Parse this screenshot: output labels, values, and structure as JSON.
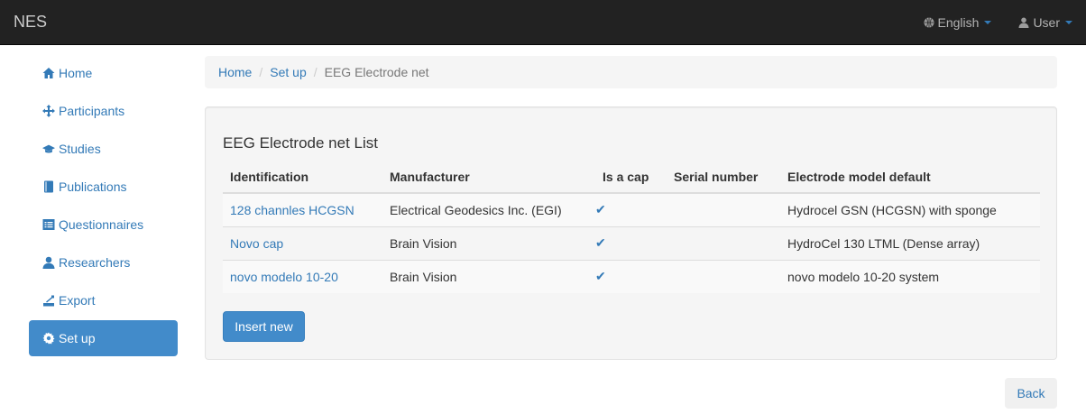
{
  "navbar": {
    "brand": "NES",
    "language": "English",
    "user": "User"
  },
  "sidebar": {
    "items": [
      {
        "label": "Home",
        "icon": "home-icon"
      },
      {
        "label": "Participants",
        "icon": "move-icon"
      },
      {
        "label": "Studies",
        "icon": "education-icon"
      },
      {
        "label": "Publications",
        "icon": "book-icon"
      },
      {
        "label": "Questionnaires",
        "icon": "list-alt-icon"
      },
      {
        "label": "Researchers",
        "icon": "user-icon"
      },
      {
        "label": "Export",
        "icon": "export-icon"
      },
      {
        "label": "Set up",
        "icon": "cog-icon",
        "active": true
      }
    ]
  },
  "breadcrumb": {
    "home": "Home",
    "setup": "Set up",
    "current": "EEG Electrode net"
  },
  "panel": {
    "title": "EEG Electrode net List",
    "columns": [
      "Identification",
      "Manufacturer",
      "Is a cap",
      "Serial number",
      "Electrode model default"
    ],
    "rows": [
      {
        "identification": "128 channles HCGSN",
        "manufacturer": "Electrical Geodesics Inc. (EGI)",
        "is_cap": "✔",
        "serial": "",
        "model": "Hydrocel GSN (HCGSN) with sponge"
      },
      {
        "identification": "Novo cap",
        "manufacturer": "Brain Vision",
        "is_cap": "✔",
        "serial": "",
        "model": "HydroCel 130 LTML (Dense array)"
      },
      {
        "identification": "novo modelo 10-20",
        "manufacturer": "Brain Vision",
        "is_cap": "✔",
        "serial": "",
        "model": "novo modelo 10-20 system"
      }
    ],
    "insert_label": "Insert new"
  },
  "back_label": "Back",
  "colors": {
    "navbar": "#222222",
    "link": "#337ab7",
    "primary": "#428bca"
  }
}
